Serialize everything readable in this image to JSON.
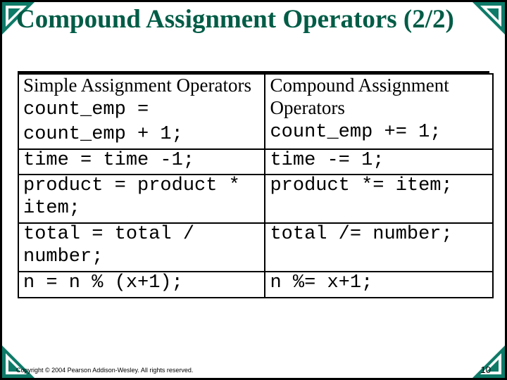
{
  "title": "Compound Assignment Operators (2/2)",
  "headers": {
    "left": "Simple Assignment Operators",
    "right": "Compound Assignment Operators"
  },
  "rows": [
    {
      "left": "count_emp = count_emp + 1;",
      "right": "count_emp += 1;"
    },
    {
      "left": "time = time -1;",
      "right": "time -= 1;"
    },
    {
      "left": "product = product * item;",
      "right": "product *= item;"
    },
    {
      "left": "total = total / number;",
      "right": "total /= number;"
    },
    {
      "left": "n = n % (x+1);",
      "right": "n %= x+1;"
    }
  ],
  "footer": "Copyright © 2004 Pearson Addison-Wesley. All rights reserved.",
  "page": "10"
}
